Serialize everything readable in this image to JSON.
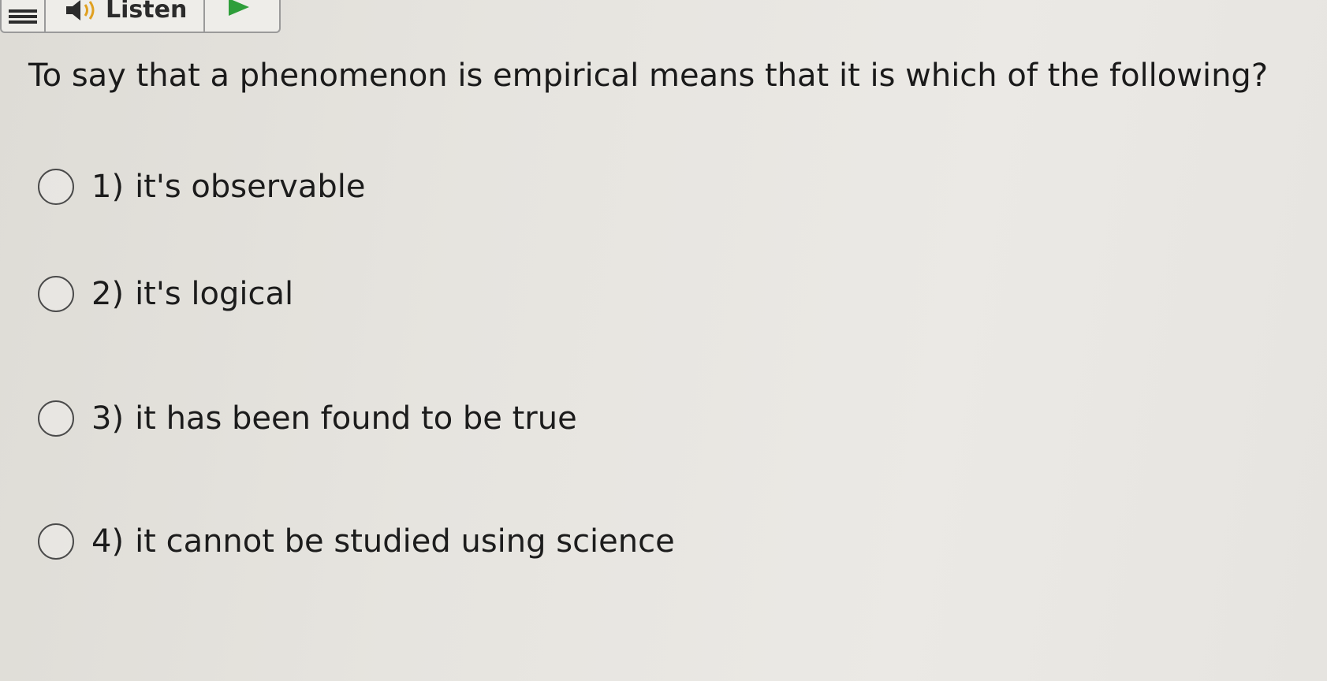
{
  "toolbar": {
    "menu_icon": "hamburger-menu-icon",
    "speaker_icon": "speaker-icon",
    "listen_label": "Listen",
    "play_icon": "play-icon",
    "accent_color": "#2e9e3a"
  },
  "question": {
    "text": "To say that a phenomenon is empirical means that it is which of the following?"
  },
  "options": [
    {
      "number": "1)",
      "text": "it's observable",
      "selected": false
    },
    {
      "number": "2)",
      "text": "it's logical",
      "selected": false
    },
    {
      "number": "3)",
      "text": "it has been found to be true",
      "selected": false
    },
    {
      "number": "4)",
      "text": "it cannot be studied using science",
      "selected": false
    }
  ]
}
